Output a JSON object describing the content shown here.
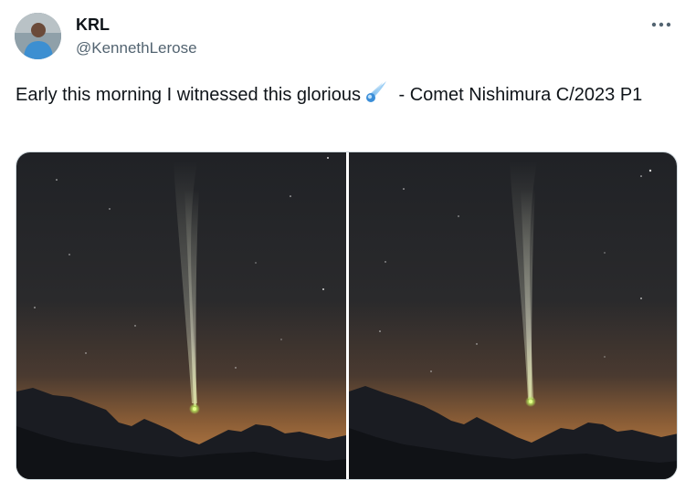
{
  "author": {
    "name": "KRL",
    "handle": "@KennethLerose",
    "avatar_icon": "profile-photo"
  },
  "more_icon": "more-horizontal-icon",
  "tweet": {
    "text_before": "Early this morning  I witnessed this glorious",
    "emoji": "comet-emoji",
    "text_after": " - Comet Nishimura C/2023 P1"
  },
  "media": {
    "photos": [
      {
        "description_icon": "comet-photo"
      },
      {
        "description_icon": "comet-photo"
      }
    ]
  },
  "colors": {
    "text": "#0f1419",
    "secondary": "#536471",
    "sky_top": "#1f2125",
    "horizon_glow": "#a8713f",
    "comet_tail": "#e8ead2",
    "comet_head": "#b4e35a"
  }
}
